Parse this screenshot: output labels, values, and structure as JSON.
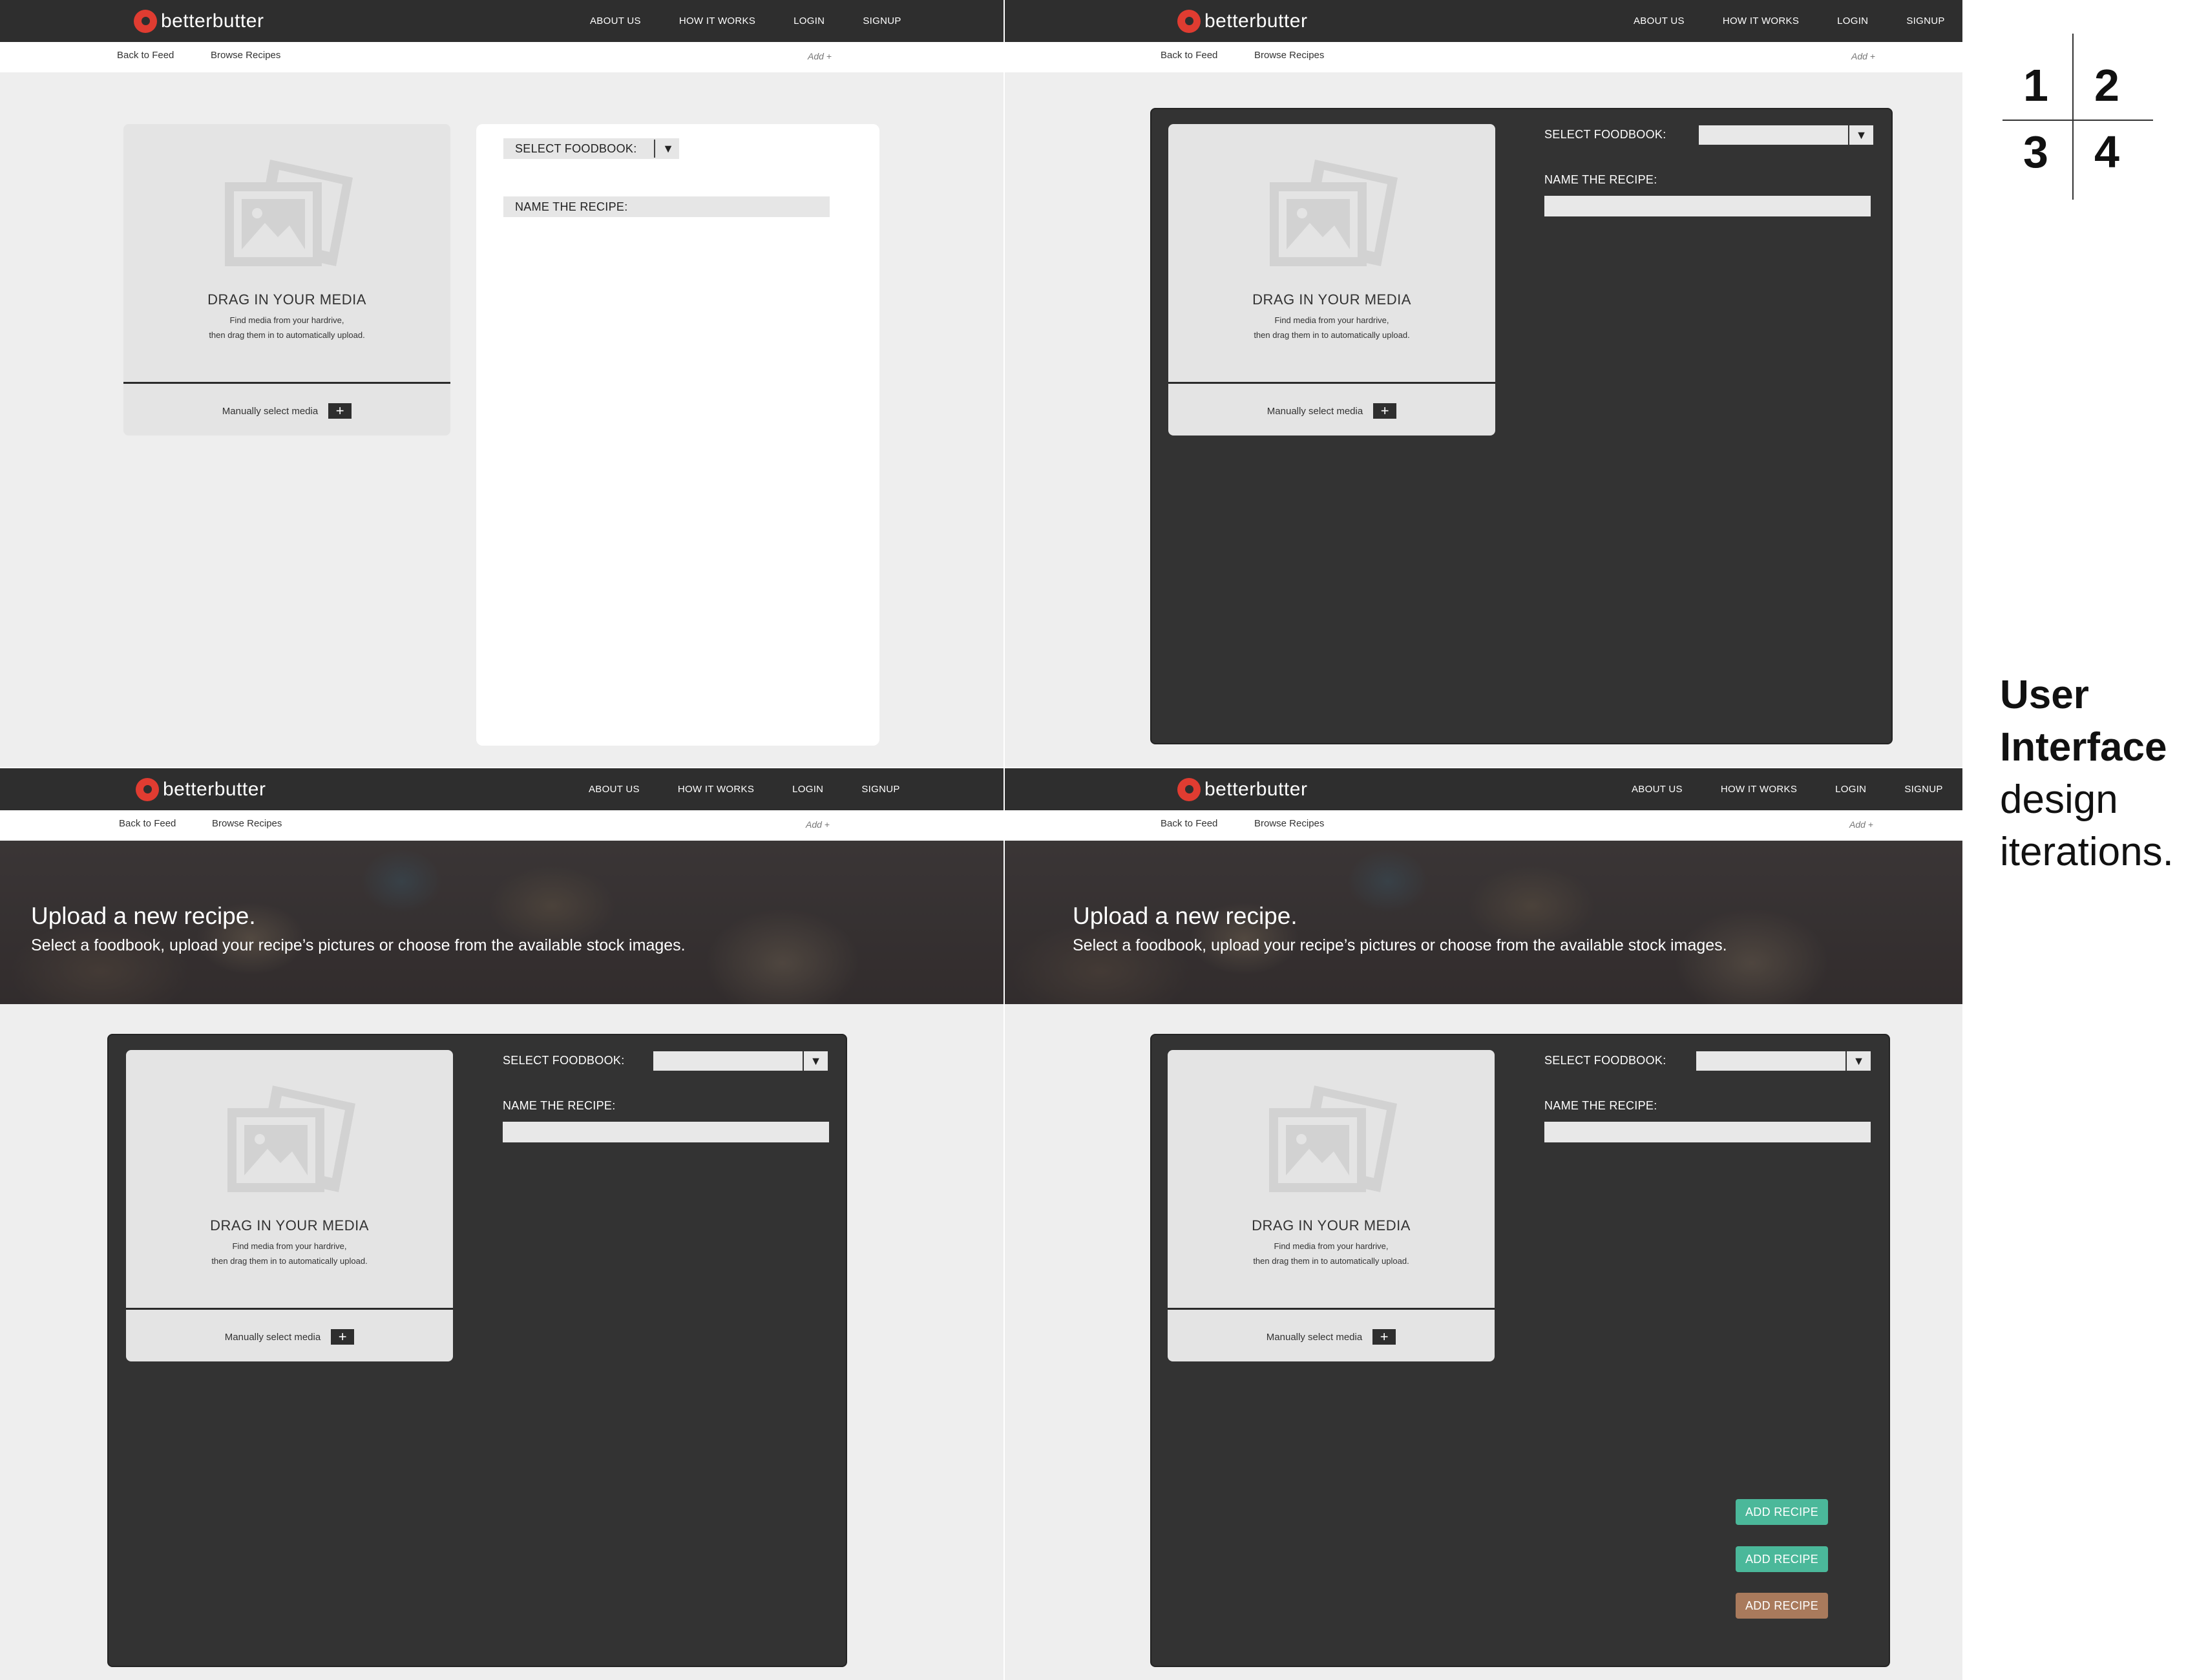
{
  "brand": {
    "name": "betterbutter",
    "accent": "#e03c31"
  },
  "nav": [
    "ABOUT US",
    "HOW IT WORKS",
    "LOGIN",
    "SIGNUP"
  ],
  "subnav": {
    "back": "Back to Feed",
    "browse": "Browse Recipes",
    "add": "Add +"
  },
  "hero": {
    "title": "Upload a new recipe.",
    "subtitle": "Select a foodbook, upload your recipe’s pictures or choose from the available stock images."
  },
  "media": {
    "title": "DRAG IN YOUR MEDIA",
    "desc_line1": "Find media from your hardrive,",
    "desc_line2": "then drag them in to automatically upload.",
    "manual": "Manually select media",
    "plus": "+",
    "icon": "image-placeholder-icon"
  },
  "form": {
    "select_label": "SELECT FOODBOOK:",
    "name_label": "NAME THE RECIPE:",
    "arrow": "▼"
  },
  "buttons": {
    "add_recipe": "ADD RECIPE",
    "colors": [
      "#4bb89a",
      "#4bb89a",
      "#a97a5c"
    ]
  },
  "legend": {
    "n1": "1",
    "n2": "2",
    "n3": "3",
    "n4": "4"
  },
  "caption": {
    "line1": "User",
    "line2": "Interface",
    "line3": "design",
    "line4": "iterations."
  },
  "colors": {
    "topbar": "#2e2e2e",
    "card_dark": "#333333",
    "page_bg": "#eeeeee"
  }
}
